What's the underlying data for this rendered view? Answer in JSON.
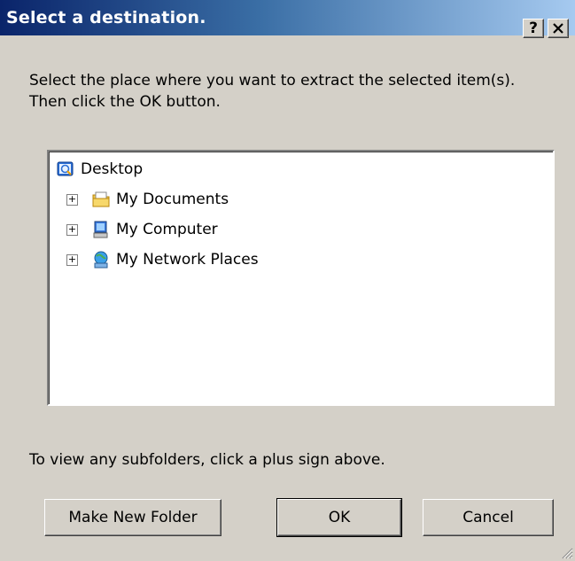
{
  "window": {
    "title": "Select a destination.",
    "help_label": "?",
    "close_label": "✕"
  },
  "instructions": "Select the place where you want to extract the selected item(s).  Then click the OK button.",
  "tree": {
    "root": {
      "label": "Desktop",
      "icon": "desktop-icon"
    },
    "children": [
      {
        "label": "My Documents",
        "icon": "documents-folder-icon",
        "expander": "+"
      },
      {
        "label": "My Computer",
        "icon": "computer-icon",
        "expander": "+"
      },
      {
        "label": "My Network Places",
        "icon": "network-places-icon",
        "expander": "+"
      }
    ]
  },
  "hint": "To view any subfolders, click a plus sign above.",
  "buttons": {
    "new_folder": "Make New Folder",
    "ok": "OK",
    "cancel": "Cancel"
  },
  "colors": {
    "titlebar_start": "#0a246a",
    "titlebar_end": "#a6caf0",
    "dialog_bg": "#d4d0c8"
  }
}
